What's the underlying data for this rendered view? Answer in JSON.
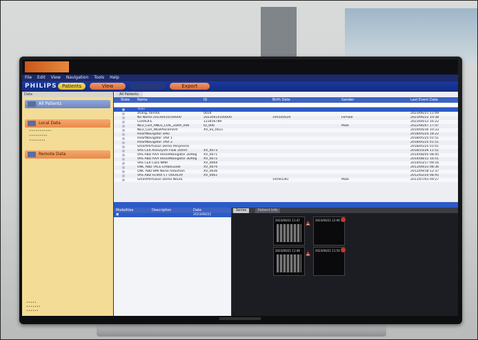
{
  "app": {
    "logo_text": "PHILIPS",
    "menu": [
      "File",
      "Edit",
      "View",
      "Navigation",
      "Tools",
      "Help"
    ],
    "tabs": [
      "Patients",
      "View",
      "Export"
    ]
  },
  "left_panel": {
    "header": "Data",
    "all_patients": "All Patients",
    "local_data": "Local Data",
    "remote_data": "Remote Data"
  },
  "main": {
    "tab": "All Patients",
    "columns": [
      "State",
      "Name",
      "ID",
      "Birth Date",
      "Gender",
      "Last Event Date"
    ],
    "rows": [
      {
        "name": "TEST",
        "id": "",
        "birth": "",
        "gender": "",
        "date": "",
        "selected": true
      },
      {
        "name": "zhang, fansha",
        "id": "0024",
        "birth": "",
        "gender": "",
        "date": "2023/06/21 11:09"
      },
      {
        "name": "No Name-20230410100000",
        "id": "20230410100000",
        "birth": "1955/04/20",
        "gender": "Female",
        "date": "2023/06/22 10:38"
      },
      {
        "name": "CERALIFE",
        "id": "123456789",
        "birth": "",
        "gender": "",
        "date": "2023/04/12 16:22"
      },
      {
        "name": "NEU_CER_ANEU_COIL_2DRA_006",
        "id": "ID_006",
        "birth": "",
        "gender": "Male",
        "date": "2022/06/07 17:47"
      },
      {
        "name": "NEU_CER_WEBPlacement",
        "id": "XV_SS_0021",
        "birth": "",
        "gender": "",
        "date": "2019/04/30 10:33"
      },
      {
        "name": "HeartNavigator SHD",
        "id": "",
        "birth": "",
        "gender": "",
        "date": "2018/05/24 18:22"
      },
      {
        "name": "HeartNavigator TAVI 1",
        "id": "",
        "birth": "",
        "gender": "",
        "date": "2018/05/25 01:51"
      },
      {
        "name": "HeartNavigator TAVI 2",
        "id": "",
        "birth": "",
        "gender": "",
        "date": "2018/05/25 01:51"
      },
      {
        "name": "SmartPerfusion Demo Peripheral",
        "id": "",
        "birth": "",
        "gender": "",
        "date": "2018/05/25 01:01"
      },
      {
        "name": "VAS CER Aneurysm Flow 16mm",
        "id": "XV_0073",
        "birth": "",
        "gender": "",
        "date": "2018/10/26 11:51"
      },
      {
        "name": "VAS ABD AAA VesselNavigator 2DReg",
        "id": "XV_0071",
        "birth": "",
        "gender": "",
        "date": "2014/08/05 08:45"
      },
      {
        "name": "VAS ABD AAA VesselNavigator 3DReg",
        "id": "XV_0072",
        "birth": "",
        "gender": "",
        "date": "2014/08/12 16:51"
      },
      {
        "name": "VAS CER Coils NMR",
        "id": "XV_0069",
        "birth": "",
        "gender": "",
        "date": "2014/03/17 09:16"
      },
      {
        "name": "ONC ABD TACE EmboGuide",
        "id": "XV_0070",
        "birth": "",
        "gender": "",
        "date": "2013/09/23 08:36"
      },
      {
        "name": "ONC ABD BMI Noise reduction",
        "id": "XV_0036",
        "birth": "",
        "gender": "",
        "date": "2012/09/18 12:37"
      },
      {
        "name": "VAS ABD FEVAR CT OVERLAY",
        "id": "XV_0061",
        "birth": "",
        "gender": "",
        "date": "2012/02/24 08:45"
      },
      {
        "name": "SmartPerfusion Demo Neuro",
        "id": "",
        "birth": "1959/1/81",
        "gender": "Male",
        "date": "2011/07/03 09:27"
      }
    ]
  },
  "studies": {
    "columns": [
      "Modalities",
      "Description",
      "Date"
    ],
    "row_date": "2023/06/21"
  },
  "series": {
    "tabs": [
      "Series",
      "Patient Info"
    ],
    "thumbs": [
      "2023/06/21 11:47",
      "2023/06/21 12:06",
      "2023/06/21 11:48",
      "2023/06/21 11:54"
    ]
  }
}
